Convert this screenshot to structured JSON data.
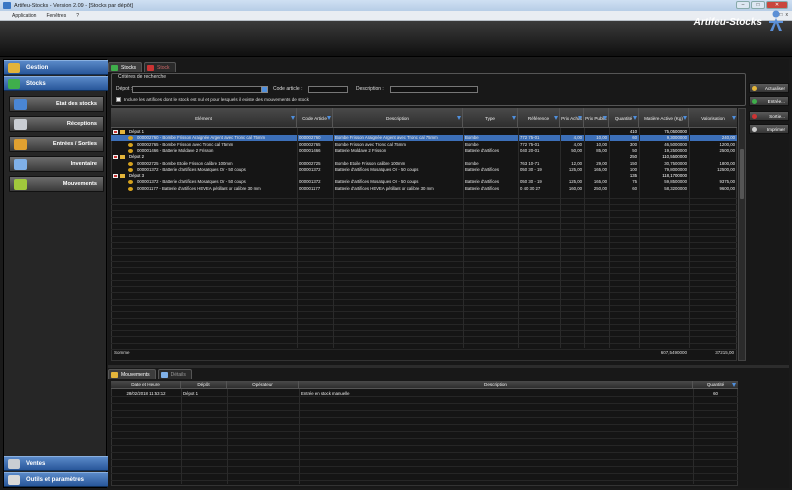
{
  "window": {
    "title": "Artifeu-Stocks - Version 2.09 - [Stocks par dépôt]",
    "controls": [
      "–",
      "□",
      "✕"
    ]
  },
  "menu": {
    "items": [
      "Application",
      "Fenêtres",
      "?"
    ],
    "mdi_controls": [
      "_",
      "□",
      "x"
    ]
  },
  "brand": "Artifeu-Stocks",
  "sidebar": {
    "sections": [
      {
        "label": "Gestion",
        "icon": "folder-icon"
      },
      {
        "label": "Stocks",
        "icon": "stocks-icon"
      }
    ],
    "buttons": [
      {
        "label": "Etat des stocks",
        "icon": "stock-state-icon"
      },
      {
        "label": "Réceptions",
        "icon": "truck-icon"
      },
      {
        "label": "Entrées / Sorties",
        "icon": "in-out-icon"
      },
      {
        "label": "Inventaire",
        "icon": "inventory-icon"
      },
      {
        "label": "Mouvements",
        "icon": "movements-icon"
      }
    ],
    "bottom": [
      {
        "label": "Ventes",
        "icon": "sales-icon"
      },
      {
        "label": "Outils et paramètres",
        "icon": "tools-icon"
      }
    ]
  },
  "tabs": [
    {
      "label": "Stocks",
      "active": true
    },
    {
      "label": "Stock",
      "active": false
    }
  ],
  "criteria": {
    "legend": "Critères de recherche",
    "depot_label": "Dépot :",
    "depot_value": "",
    "code_label": "Code article :",
    "code_value": "",
    "desc_label": "Description :",
    "desc_value": "",
    "checkbox_label": "Inclure les artifices dont le stock est nul et pour lesquels il existe des mouvements de stock",
    "checked": false
  },
  "table": {
    "columns": [
      "Elément",
      "Code Article",
      "Description",
      "Type",
      "Référence",
      "Prix Achat",
      "Prix Public",
      "Quantité",
      "Matière Active (Kg)",
      "Valorisation"
    ],
    "rows": [
      {
        "kind": "group",
        "cells": [
          "Dépot 1",
          "",
          "",
          "",
          "",
          "",
          "",
          "410",
          "75,0500000",
          ""
        ]
      },
      {
        "kind": "item",
        "selected": true,
        "cells": [
          "000002760 - Bombe Frisson Araignée Argent avec Tronc cal 75mm",
          "000002760",
          "Bombe Frisson Araignée Argent avec Tronc cal 75mm",
          "Bombe",
          "772 75-01",
          "4,00",
          "10,00",
          "60",
          "9,3000000",
          "240,00"
        ]
      },
      {
        "kind": "item",
        "cells": [
          "000002765 - Bombe Frisson avec Tronc cal 75mm",
          "000002765",
          "Bombe Frisson avec Tronc cal 75mm",
          "Bombe",
          "772 75-01",
          "4,00",
          "10,00",
          "300",
          "46,5000000",
          "1200,00"
        ]
      },
      {
        "kind": "item",
        "cells": [
          "000001466 - Batterie Moldave 2 Frisson",
          "000001466",
          "Batterie Moldave 2 Frisson",
          "Batterie d'artifices",
          "040 20-01",
          "50,00",
          "85,00",
          "50",
          "19,2500000",
          "2500,00"
        ]
      },
      {
        "kind": "group",
        "cells": [
          "Dépot 2",
          "",
          "",
          "",
          "",
          "",
          "",
          "250",
          "110,5500000",
          ""
        ]
      },
      {
        "kind": "item",
        "cells": [
          "000002725 - Bombe Etoile Frisson calibre 100mm",
          "000002725",
          "Bombe Etoile Frisson calibre 100mm",
          "Bombe",
          "763 10-71",
          "12,00",
          "29,00",
          "150",
          "30,7500000",
          "1800,00"
        ]
      },
      {
        "kind": "item",
        "cells": [
          "000001372 - Batterie d'artifices Mosaïques Or - 50 coups",
          "000001372",
          "Batterie d'artifices Mosaïques Or - 50 coups",
          "Batterie d'artifices",
          "050 30 - 19",
          "125,00",
          "165,00",
          "100",
          "79,8000000",
          "12500,00"
        ]
      },
      {
        "kind": "group",
        "cells": [
          "Dépot 3",
          "",
          "",
          "",
          "",
          "",
          "",
          "135",
          "118,1700000",
          ""
        ]
      },
      {
        "kind": "item",
        "cells": [
          "000001372 - Batterie d'artifices Mosaïques Or - 50 coups",
          "000001372",
          "Batterie d'artifices Mosaïques Or - 50 coups",
          "Batterie d'artifices",
          "050 30 - 19",
          "125,00",
          "165,00",
          "75",
          "59,8500000",
          "9375,00"
        ]
      },
      {
        "kind": "item",
        "cells": [
          "000001177 - Batterie d'artifices HEVEA pétillant or calibre 30 mm",
          "000001177",
          "Batterie d'artifices HEVEA pétillant or calibre 30 mm",
          "Batterie d'artifices",
          "0 40 30 27",
          "160,00",
          "250,00",
          "60",
          "58,3200000",
          "9600,00"
        ]
      }
    ],
    "footer": {
      "label": "Somme",
      "matiere": "607,5490000",
      "valorisation": "37215,00"
    }
  },
  "right_buttons": [
    {
      "label": "Actualiser",
      "icon": "refresh-icon"
    },
    {
      "label": "Entrée...",
      "icon": "entry-icon"
    },
    {
      "label": "Sortie...",
      "icon": "exit-icon"
    },
    {
      "label": "Imprimer",
      "icon": "print-icon"
    }
  ],
  "bottom_tabs": [
    {
      "label": "Mouvements",
      "active": true
    },
    {
      "label": "Détails",
      "active": false
    }
  ],
  "movements": {
    "columns": [
      "Date et Heure",
      "Dépôt",
      "Opérateur",
      "Description",
      "Quantité"
    ],
    "rows": [
      [
        "28/02/2018 11:53:12",
        "Dépot 1",
        "",
        "Entrée en stock manuelle",
        "60"
      ]
    ]
  }
}
